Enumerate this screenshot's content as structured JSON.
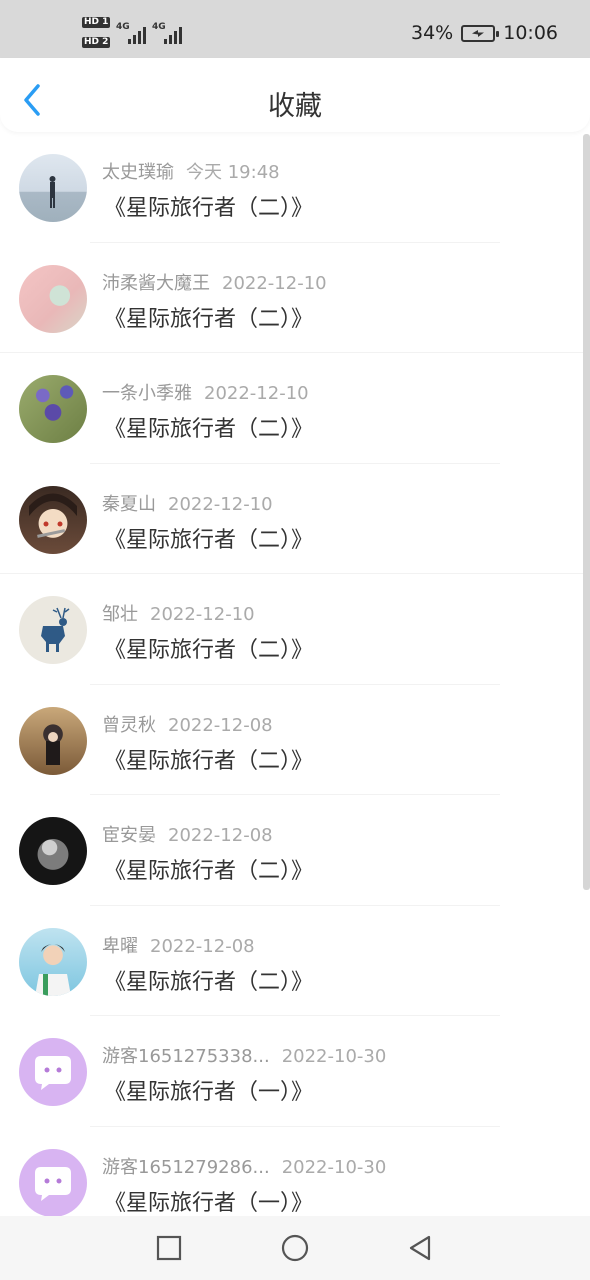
{
  "status_bar": {
    "sim1_label": "HD 1",
    "sim2_label": "HD 2",
    "network1": "4G",
    "network2": "4G",
    "battery": "34%",
    "time": "10:06"
  },
  "header": {
    "title": "收藏",
    "back_icon": "chevron-left-icon"
  },
  "favorites": [
    {
      "user": "太史璞瑜",
      "time": "今天 19:48",
      "work": "《星际旅行者（二）》",
      "avatar": "sea"
    },
    {
      "user": "沛柔酱大魔王",
      "time": "2022-12-10",
      "work": "《星际旅行者（二）》",
      "avatar": "pink"
    },
    {
      "user": "一条小季雅",
      "time": "2022-12-10",
      "work": "《星际旅行者（二）》",
      "avatar": "flower"
    },
    {
      "user": "秦夏山",
      "time": "2022-12-10",
      "work": "《星际旅行者（二）》",
      "avatar": "anime"
    },
    {
      "user": "邹壮",
      "time": "2022-12-10",
      "work": "《星际旅行者（二）》",
      "avatar": "deer"
    },
    {
      "user": "曾灵秋",
      "time": "2022-12-08",
      "work": "《星际旅行者（二）》",
      "avatar": "girl"
    },
    {
      "user": "宦安晏",
      "time": "2022-12-08",
      "work": "《星际旅行者（二）》",
      "avatar": "dark"
    },
    {
      "user": "卑曜",
      "time": "2022-12-08",
      "work": "《星际旅行者（二）》",
      "avatar": "boy"
    },
    {
      "user": "游客1651275338...",
      "time": "2022-10-30",
      "work": "《星际旅行者（一）》",
      "avatar": "chat"
    },
    {
      "user": "游客1651279286...",
      "time": "2022-10-30",
      "work": "《星际旅行者（一）》",
      "avatar": "chat"
    }
  ],
  "nav": {
    "recents_icon": "square-icon",
    "home_icon": "circle-icon",
    "back_icon": "triangle-back-icon"
  },
  "colors": {
    "accent": "#2a9df4",
    "status_bar_bg": "#d9d9d9",
    "name_text": "#999999",
    "work_text": "#333333"
  }
}
